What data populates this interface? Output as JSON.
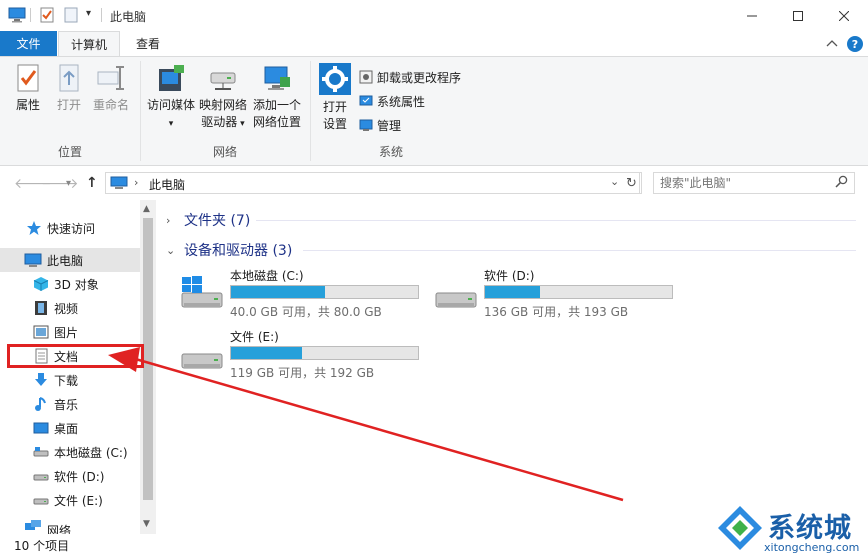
{
  "window": {
    "title": "此电脑",
    "qat_dropdown": "▾"
  },
  "ribbon_tabs": {
    "file": "文件",
    "computer": "计算机",
    "view": "查看"
  },
  "ribbon": {
    "location": {
      "label": "位置",
      "properties": "属性",
      "open": "打开",
      "rename": "重命名"
    },
    "network": {
      "label": "网络",
      "access_media_line1": "访问媒体",
      "map_drive_line1": "映射网络",
      "map_drive_line2": "驱动器",
      "add_location_line1": "添加一个",
      "add_location_line2": "网络位置"
    },
    "system": {
      "label": "系统",
      "open_settings_line1": "打开",
      "open_settings_line2": "设置",
      "uninstall": "卸载或更改程序",
      "system_properties": "系统属性",
      "manage": "管理"
    }
  },
  "address": {
    "path": "此电脑",
    "search_placeholder": "搜索\"此电脑\""
  },
  "nav": {
    "quick_access": "快速访问",
    "this_pc": "此电脑",
    "objects_3d": "3D 对象",
    "videos": "视频",
    "pictures": "图片",
    "documents": "文档",
    "downloads": "下载",
    "music": "音乐",
    "desktop": "桌面",
    "local_disk": "本地磁盘 (C:)",
    "software_disk": "软件 (D:)",
    "document_disk": "文件 (E:)",
    "network": "网络"
  },
  "content": {
    "folders_header": "文件夹 (7)",
    "devices_header": "设备和驱动器 (3)",
    "drives": [
      {
        "name": "本地磁盘 (C:)",
        "info": "40.0 GB 可用，共 80.0 GB",
        "used_fraction": 0.5
      },
      {
        "name": "软件 (D:)",
        "info": "136 GB 可用，共 193 GB",
        "used_fraction": 0.295
      },
      {
        "name": "文件 (E:)",
        "info": "119 GB 可用，共 192 GB",
        "used_fraction": 0.38
      }
    ]
  },
  "status": {
    "item_count": "10 个项目"
  },
  "watermark": {
    "title": "系统城",
    "subtitle": "xitongcheng.com"
  },
  "colors": {
    "accent": "#1979ca",
    "drive_fill": "#26a0da",
    "annotation": "#e02222"
  }
}
